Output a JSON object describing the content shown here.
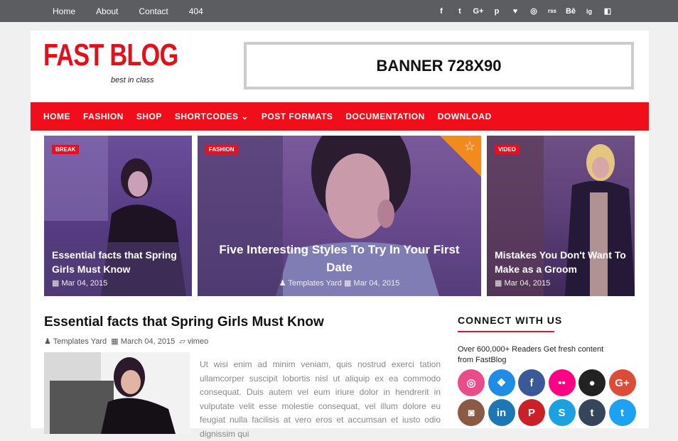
{
  "topnav": {
    "items": [
      "Home",
      "About",
      "Contact",
      "404"
    ]
  },
  "top_social": [
    "f",
    "t",
    "G+",
    "p",
    "♥",
    "◎",
    "rss",
    "Bē",
    "ig",
    "◧"
  ],
  "logo": {
    "title": "FAST BLOG",
    "tagline": "best in class"
  },
  "banner": {
    "text": "BANNER 728X90"
  },
  "mainnav": {
    "items": [
      "HOME",
      "FASHION",
      "SHOP",
      "SHORTCODES ⌄",
      "POST FORMATS",
      "DOCUMENTATION",
      "DOWNLOAD"
    ]
  },
  "featured": [
    {
      "tag": "BREAK",
      "title": "Essential facts that Spring Girls Must Know",
      "date": "Mar 04, 2015"
    },
    {
      "tag": "FASHION",
      "title": "Five Interesting Styles To Try In Your First Date",
      "author": "Templates Yard",
      "date": "Mar 04, 2015"
    },
    {
      "tag": "VIDEO",
      "title": "Mistakes You Don't Want To Make as a Groom",
      "date": "Mar 04, 2015"
    }
  ],
  "post": {
    "title": "Essential facts that Spring Girls Must Know",
    "author": "Templates Yard",
    "date": "March 04, 2015",
    "category": "vimeo",
    "excerpt": "Ut wisi enim ad minim veniam, quis nostrud exerci tation ullamcorper suscipit lobortis nisl ut aliquip ex ea commodo consequat. Duis autem vel eum iriure dolor in hendrerit in vulputate velit esse molestie consequat, vel illum dolore eu feugiat nulla facilisis at vero eros et accumsan et iusto odio dignissim qui"
  },
  "sidebar": {
    "heading": "CONNECT WITH US",
    "text": "Over 600,000+ Readers Get fresh content from FastBlog",
    "icons": [
      {
        "name": "dribbble",
        "glyph": "◎",
        "color": "#ea4c89"
      },
      {
        "name": "dropbox",
        "glyph": "❖",
        "color": "#1f8ce6"
      },
      {
        "name": "facebook",
        "glyph": "f",
        "color": "#3b5998"
      },
      {
        "name": "flickr",
        "glyph": "••",
        "color": "#ff0084"
      },
      {
        "name": "github",
        "glyph": "●",
        "color": "#222222"
      },
      {
        "name": "google-plus",
        "glyph": "G+",
        "color": "#dd4b39"
      },
      {
        "name": "instagram",
        "glyph": "◙",
        "color": "#8a5a44"
      },
      {
        "name": "linkedin",
        "glyph": "in",
        "color": "#1c78b4"
      },
      {
        "name": "pinterest",
        "glyph": "P",
        "color": "#cb2027"
      },
      {
        "name": "skype",
        "glyph": "S",
        "color": "#1ba1e2"
      },
      {
        "name": "tumblr",
        "glyph": "t",
        "color": "#35465c"
      },
      {
        "name": "twitter",
        "glyph": "t",
        "color": "#1da1f2"
      }
    ]
  }
}
